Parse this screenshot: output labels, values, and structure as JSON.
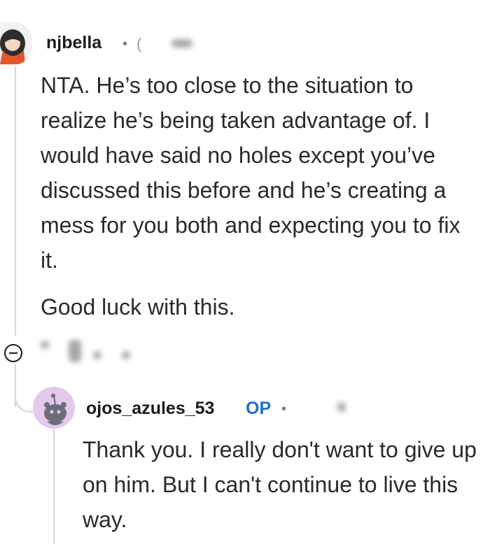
{
  "comment": {
    "username": "njbella",
    "separator": "•",
    "paragraphs": [
      "NTA. He’s too close to the situation to realize he’s being taken advantage of. I would have said no holes except you’ve discussed this before and he’s creating a mess for you both and expecting you to fix it.",
      "Good luck with this."
    ]
  },
  "reply": {
    "username": "ojos_azules_53",
    "op_badge": "OP",
    "separator": "•",
    "text": "Thank you. I really don't want to give up on him. But I can't continue to live this way."
  },
  "colors": {
    "op_blue": "#1a6ecf",
    "text": "#2a2a2a",
    "avatar_reply_bg": "#e4c8ee"
  }
}
